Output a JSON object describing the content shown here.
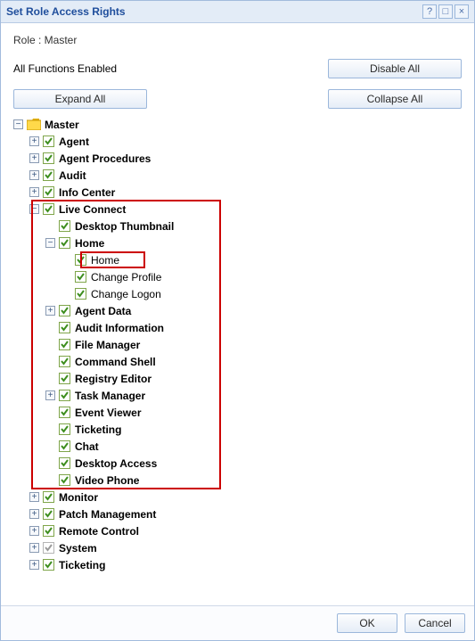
{
  "window": {
    "title": "Set Role Access Rights"
  },
  "info": {
    "role_label": "Role : Master",
    "all_enabled": "All Functions Enabled"
  },
  "buttons": {
    "disable_all": "Disable All",
    "expand_all": "Expand All",
    "collapse_all": "Collapse All",
    "ok": "OK",
    "cancel": "Cancel"
  },
  "tree": {
    "root": "Master",
    "n_agent": "Agent",
    "n_agent_procedures": "Agent Procedures",
    "n_audit": "Audit",
    "n_info_center": "Info Center",
    "n_live_connect": "Live Connect",
    "lc_desktop_thumbnail": "Desktop Thumbnail",
    "lc_home": "Home",
    "lc_home_home": "Home",
    "lc_home_change_profile": "Change Profile",
    "lc_home_change_logon": "Change Logon",
    "lc_agent_data": "Agent Data",
    "lc_audit_information": "Audit Information",
    "lc_file_manager": "File Manager",
    "lc_command_shell": "Command Shell",
    "lc_registry_editor": "Registry Editor",
    "lc_task_manager": "Task Manager",
    "lc_event_viewer": "Event Viewer",
    "lc_ticketing": "Ticketing",
    "lc_chat": "Chat",
    "lc_desktop_access": "Desktop Access",
    "lc_video_phone": "Video Phone",
    "n_monitor": "Monitor",
    "n_patch_management": "Patch Management",
    "n_remote_control": "Remote Control",
    "n_system": "System",
    "n_ticketing": "Ticketing"
  }
}
